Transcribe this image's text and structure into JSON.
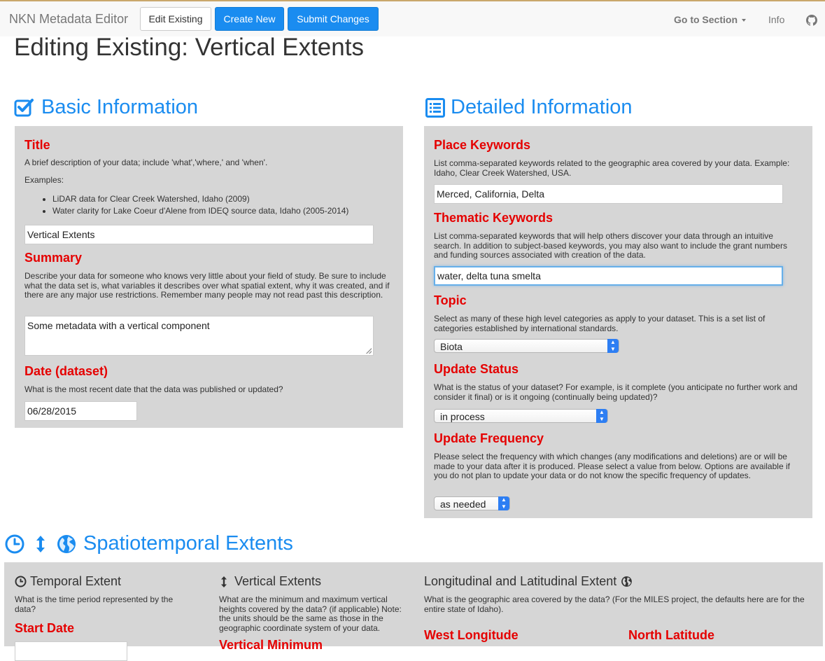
{
  "navbar": {
    "brand": "NKN Metadata Editor",
    "edit_existing": "Edit Existing",
    "create_new": "Create New",
    "submit_changes": "Submit Changes",
    "go_to_section": "Go to Section",
    "info": "Info",
    "github_icon": "github-icon"
  },
  "page_title": "Editing Existing: Vertical Extents",
  "basic": {
    "heading": "Basic Information",
    "icon": "check-square-icon",
    "title_label": "Title",
    "title_help": "A brief description of your data; include 'what','where,' and 'when'.",
    "examples_label": "Examples:",
    "examples": [
      "LiDAR data for Clear Creek Watershed, Idaho (2009)",
      "Water clarity for Lake Coeur d'Alene from IDEQ source data, Idaho (2005-2014)"
    ],
    "title_value": "Vertical Extents",
    "summary_label": "Summary",
    "summary_help": "Describe your data for someone who knows very little about your field of study. Be sure to include what the data set is, what variables it describes over what spatial extent, why it was created, and if there are any major use restrictions. Remember many people may not read past this description.",
    "summary_value": "Some metadata with a vertical component",
    "date_label": "Date (dataset)",
    "date_help": "What is the most recent date that the data was published or updated?",
    "date_value": "06/28/2015"
  },
  "detailed": {
    "heading": "Detailed Information",
    "icon": "list-icon",
    "place_label": "Place Keywords",
    "place_help": "List comma-separated keywords related to the geographic area covered by your data. Example: Idaho, Clear Creek Watershed, USA.",
    "place_value": "Merced, California, Delta",
    "thematic_label": "Thematic Keywords",
    "thematic_help": "List comma-separated keywords that will help others discover your data through an intuitive search. In addition to subject-based keywords, you may also want to include the grant numbers and funding sources associated with creation of the data.",
    "thematic_value": "water, delta tuna smelta",
    "topic_label": "Topic",
    "topic_help": "Select as many of these high level categories as apply to your dataset. This is a set list of categories established by international standards.",
    "topic_value": "Biota",
    "status_label": "Update Status",
    "status_help": "What is the status of your dataset? For example, is it complete (you anticipate no further work and consider it final) or is it ongoing (continually being updated)?",
    "status_value": "in process",
    "frequency_label": "Update Frequency",
    "frequency_help": "Please select the frequency with which changes (any modifications and deletions) are or will be made to your data after it is produced. Please select a value from below. Options are available if you do not plan to update your data or do not know the specific frequency of updates.",
    "frequency_value": "as needed"
  },
  "spatiotemporal": {
    "heading": "Spatiotemporal Extents",
    "icons": [
      "clock-icon",
      "vertical-arrows-icon",
      "globe-icon"
    ],
    "temporal_heading": "Temporal Extent",
    "temporal_help": "What is the time period represented by the data?",
    "start_date_label": "Start Date",
    "vertical_heading": "Vertical Extents",
    "vertical_help": "What are the minimum and maximum vertical heights covered by the data? (if applicable) Note: the units should be the same as those in the geographic coordinate system of your data.",
    "vertical_min_label": "Vertical Minimum",
    "lonlat_heading": "Longitudinal and Latitudinal Extent",
    "lonlat_help": "What is the geographic area covered by the data? (For the MILES project, the defaults here are for the entire state of Idaho).",
    "west_label": "West Longitude",
    "north_label": "North Latitude"
  },
  "colors": {
    "accent": "#1a8cf0",
    "label_red": "#e50000",
    "panel_gray": "#d6d6d6"
  }
}
